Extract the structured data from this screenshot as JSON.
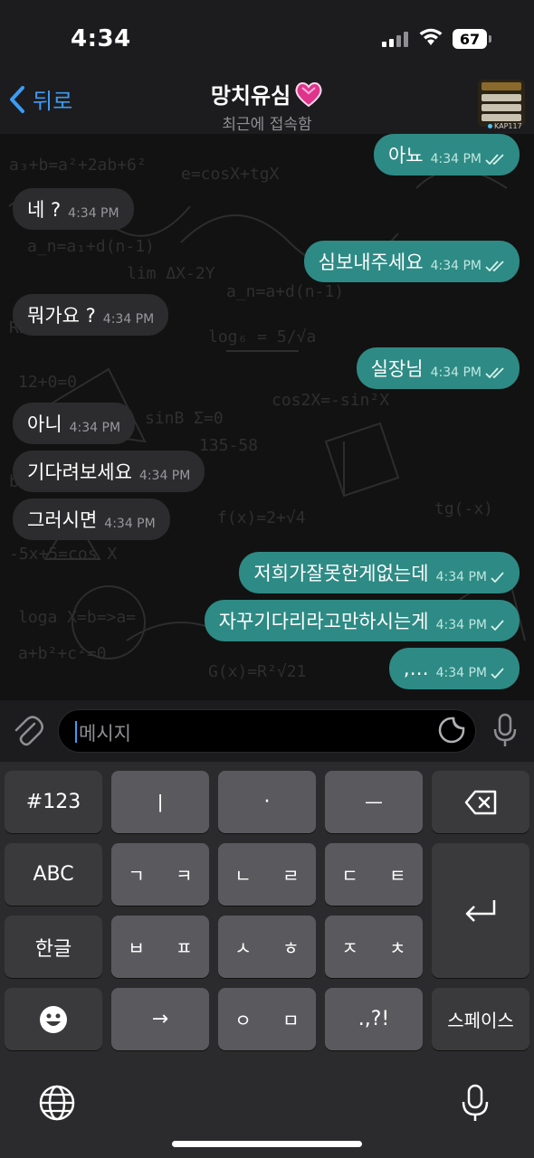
{
  "status": {
    "time": "4:34",
    "battery": "67"
  },
  "nav": {
    "back_label": "뒤로",
    "title": "망치유심",
    "subtitle": "최근에 접속함",
    "avatar_caption": "KAP117"
  },
  "messages": [
    {
      "dir": "out",
      "text": "아뇨",
      "time": "4:34 PM",
      "status": "read"
    },
    {
      "dir": "in",
      "text": "네 ?",
      "time": "4:34 PM"
    },
    {
      "dir": "out",
      "text": "심보내주세요",
      "time": "4:34 PM",
      "status": "read"
    },
    {
      "dir": "in",
      "text": "뭐가요 ?",
      "time": "4:34 PM"
    },
    {
      "dir": "out",
      "text": "실장님",
      "time": "4:34 PM",
      "status": "read"
    },
    {
      "dir": "in",
      "text": "아니",
      "time": "4:34 PM"
    },
    {
      "dir": "in",
      "text": "기다려보세요",
      "time": "4:34 PM"
    },
    {
      "dir": "in",
      "text": "그러시면",
      "time": "4:34 PM"
    },
    {
      "dir": "out",
      "text": "저희가잘못한게없는데",
      "time": "4:34 PM",
      "status": "sent"
    },
    {
      "dir": "out",
      "text": "자꾸기다리라고만하시는게",
      "time": "4:34 PM",
      "status": "sent"
    },
    {
      "dir": "out",
      "text": ",…",
      "time": "4:34 PM",
      "status": "sent"
    }
  ],
  "input": {
    "placeholder": "메시지"
  },
  "keyboard": {
    "row1": [
      "#123",
      "ㅣ",
      "·",
      "ㅡ"
    ],
    "row2": [
      "ABC",
      "ㄱ ㅋ",
      "ㄴ ㄹ",
      "ㄷ ㅌ"
    ],
    "row3": [
      "한글",
      "ㅂ ㅍ",
      "ㅅ ㅎ",
      "ㅈ ㅊ"
    ],
    "row4": [
      "→",
      "ㅇ ㅁ",
      ".,?!",
      "스페이스"
    ]
  },
  "colors": {
    "accent": "#3e9bf3",
    "outgoing": "#2e8a84",
    "incoming": "#2c2c2e"
  }
}
